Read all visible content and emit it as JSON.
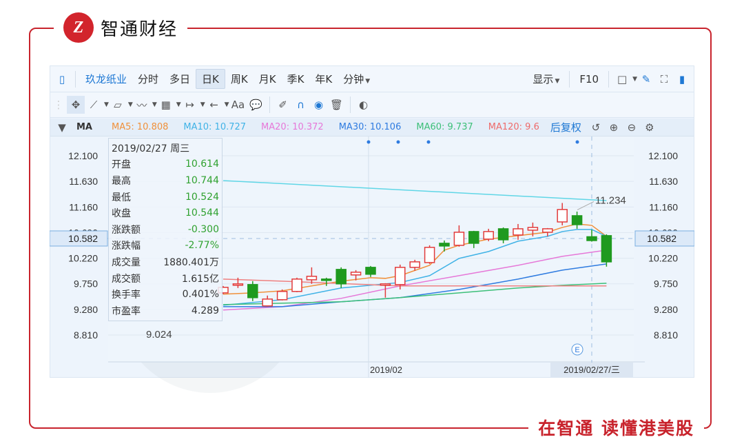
{
  "brand": {
    "logo_text": "智通财经",
    "logo_mark": "Z",
    "slogan": "在智通 读懂港美股",
    "accent": "#c8232c",
    "watermark": "智通财经"
  },
  "toolbar": {
    "stock_name": "玖龙纸业",
    "tabs": [
      "分时",
      "多日",
      "日K",
      "周K",
      "月K",
      "季K",
      "年K",
      "分钟"
    ],
    "active_tab": "日K",
    "display_label": "显示",
    "f10_label": "F10",
    "draw_tools": [
      "move-icon",
      "line-icon",
      "polygon-icon",
      "wave-icon",
      "fib-icon",
      "range-icon",
      "arrow-icon",
      "text-icon",
      "comment-icon",
      "pencil-icon",
      "magnet-icon",
      "eye-icon",
      "trash-icon",
      "compare-icon"
    ],
    "text_tool_label": "Aa"
  },
  "ma_bar": {
    "label": "MA",
    "items": [
      {
        "text": "MA5: 10.808",
        "color": "#f0903a"
      },
      {
        "text": "MA10: 10.727",
        "color": "#3fb2e6"
      },
      {
        "text": "MA20: 10.372",
        "color": "#e678d8"
      },
      {
        "text": "MA30: 10.106",
        "color": "#2e7be0"
      },
      {
        "text": "MA60: 9.737",
        "color": "#3cbf78"
      },
      {
        "text": "MA120: 9.6",
        "color": "#ee6a6a"
      }
    ],
    "adjust_label": "后复权"
  },
  "tooltip": {
    "date": "2019/02/27 周三",
    "rows": [
      {
        "label": "开盘",
        "value": "10.614",
        "green": true
      },
      {
        "label": "最高",
        "value": "10.744",
        "green": true
      },
      {
        "label": "最低",
        "value": "10.524",
        "green": true
      },
      {
        "label": "收盘",
        "value": "10.544",
        "green": true
      },
      {
        "label": "涨跌额",
        "value": "-0.300",
        "green": true
      },
      {
        "label": "涨跌幅",
        "value": "-2.77%",
        "green": true
      },
      {
        "label": "成交量",
        "value": "1880.401万",
        "green": false
      },
      {
        "label": "成交额",
        "value": "1.615亿",
        "green": false
      },
      {
        "label": "换手率",
        "value": "0.401%",
        "green": false
      },
      {
        "label": "市盈率",
        "value": "4.289",
        "green": false
      }
    ]
  },
  "chart_data": {
    "type": "candlestick",
    "y_ticks": [
      "12.100",
      "11.630",
      "11.160",
      "10.690",
      "10.220",
      "9.750",
      "9.280",
      "8.810"
    ],
    "ylim": [
      8.81,
      12.1
    ],
    "grid": true,
    "x_labels": [
      "2019/02"
    ],
    "crosshair": {
      "price": "10.582",
      "date": "2019/02/27/三",
      "index": 26
    },
    "max_label": "11.234",
    "min_label": "9.024",
    "event_marker": "E",
    "up_color": "#e23b3b",
    "down_color": "#1f9a1f",
    "candles": [
      {
        "o": 9.584,
        "h": 9.71,
        "l": 9.56,
        "c": 9.685
      },
      {
        "o": 9.74,
        "h": 9.862,
        "l": 9.673,
        "c": 9.749
      },
      {
        "o": 9.736,
        "h": 9.799,
        "l": 9.433,
        "c": 9.496
      },
      {
        "o": 9.344,
        "h": 9.534,
        "l": 9.331,
        "c": 9.47
      },
      {
        "o": 9.458,
        "h": 9.647,
        "l": 9.445,
        "c": 9.61
      },
      {
        "o": 9.61,
        "h": 9.862,
        "l": 9.597,
        "c": 9.837
      },
      {
        "o": 9.824,
        "h": 10.052,
        "l": 9.749,
        "c": 9.888
      },
      {
        "o": 9.837,
        "h": 9.862,
        "l": 9.711,
        "c": 9.812
      },
      {
        "o": 10.014,
        "h": 10.052,
        "l": 9.673,
        "c": 9.749
      },
      {
        "o": 9.913,
        "h": 10.001,
        "l": 9.812,
        "c": 9.963
      },
      {
        "o": 10.052,
        "h": 10.077,
        "l": 9.875,
        "c": 9.926
      },
      {
        "o": 9.736,
        "h": 9.761,
        "l": 9.496,
        "c": 9.749
      },
      {
        "o": 9.736,
        "h": 10.102,
        "l": 9.647,
        "c": 10.052
      },
      {
        "o": 10.052,
        "h": 10.191,
        "l": 9.989,
        "c": 10.153
      },
      {
        "o": 10.14,
        "h": 10.457,
        "l": 10.115,
        "c": 10.419
      },
      {
        "o": 10.494,
        "h": 10.545,
        "l": 10.343,
        "c": 10.444
      },
      {
        "o": 10.457,
        "h": 10.823,
        "l": 10.431,
        "c": 10.697
      },
      {
        "o": 10.709,
        "h": 10.722,
        "l": 10.406,
        "c": 10.494
      },
      {
        "o": 10.57,
        "h": 10.76,
        "l": 10.532,
        "c": 10.709
      },
      {
        "o": 10.76,
        "h": 10.785,
        "l": 10.494,
        "c": 10.558
      },
      {
        "o": 10.646,
        "h": 10.848,
        "l": 10.558,
        "c": 10.76
      },
      {
        "o": 10.735,
        "h": 10.874,
        "l": 10.621,
        "c": 10.785
      },
      {
        "o": 10.697,
        "h": 10.773,
        "l": 10.621,
        "c": 10.76
      },
      {
        "o": 10.886,
        "h": 11.234,
        "l": 10.823,
        "c": 11.114
      },
      {
        "o": 11.0,
        "h": 11.076,
        "l": 10.76,
        "c": 10.836
      },
      {
        "o": 10.614,
        "h": 10.744,
        "l": 10.524,
        "c": 10.544
      },
      {
        "o": 10.634,
        "h": 10.659,
        "l": 10.065,
        "c": 10.153
      }
    ],
    "series": [
      {
        "name": "MA5",
        "color": "#f0903a",
        "points": [
          [
            1,
            9.559
          ],
          [
            3,
            9.584
          ],
          [
            5,
            9.622
          ],
          [
            7,
            9.711
          ],
          [
            9,
            9.799
          ],
          [
            11,
            9.862
          ],
          [
            12,
            9.85
          ],
          [
            13,
            9.9
          ],
          [
            15,
            10.09
          ],
          [
            16,
            10.368
          ],
          [
            17,
            10.457
          ],
          [
            19,
            10.57
          ],
          [
            21,
            10.634
          ],
          [
            23,
            10.697
          ],
          [
            24,
            10.785
          ],
          [
            25,
            10.848
          ],
          [
            26,
            10.823
          ],
          [
            27,
            10.621
          ]
        ]
      },
      {
        "name": "MA10",
        "color": "#3fb2e6",
        "points": [
          [
            1,
            9.357
          ],
          [
            5,
            9.458
          ],
          [
            9,
            9.673
          ],
          [
            13,
            9.774
          ],
          [
            15,
            9.9
          ],
          [
            17,
            10.216
          ],
          [
            19,
            10.343
          ],
          [
            21,
            10.532
          ],
          [
            23,
            10.621
          ],
          [
            24,
            10.709
          ],
          [
            25,
            10.747
          ],
          [
            26,
            10.747
          ],
          [
            27,
            10.621
          ]
        ]
      },
      {
        "name": "MA20",
        "color": "#e678d8",
        "points": [
          [
            1,
            9.268
          ],
          [
            5,
            9.331
          ],
          [
            9,
            9.483
          ],
          [
            13,
            9.711
          ],
          [
            17,
            9.9
          ],
          [
            21,
            10.09
          ],
          [
            24,
            10.254
          ],
          [
            27,
            10.368
          ]
        ]
      },
      {
        "name": "MA30",
        "color": "#2e7be0",
        "points": [
          [
            1,
            9.331
          ],
          [
            5,
            9.331
          ],
          [
            9,
            9.42
          ],
          [
            13,
            9.496
          ],
          [
            17,
            9.647
          ],
          [
            21,
            9.837
          ],
          [
            24,
            10.001
          ],
          [
            27,
            10.115
          ]
        ]
      },
      {
        "name": "MA60",
        "color": "#3cbf78",
        "points": [
          [
            1,
            9.369
          ],
          [
            9,
            9.42
          ],
          [
            13,
            9.496
          ],
          [
            17,
            9.584
          ],
          [
            21,
            9.673
          ],
          [
            24,
            9.723
          ],
          [
            27,
            9.761
          ]
        ]
      },
      {
        "name": "MA120",
        "color": "#ee8080",
        "points": [
          [
            1,
            9.837
          ],
          [
            5,
            9.799
          ],
          [
            13,
            9.711
          ],
          [
            21,
            9.711
          ],
          [
            27,
            9.711
          ]
        ]
      },
      {
        "color": "#5fd6e6",
        "points": [
          [
            1,
            11.645
          ],
          [
            27,
            11.278
          ]
        ]
      }
    ]
  }
}
